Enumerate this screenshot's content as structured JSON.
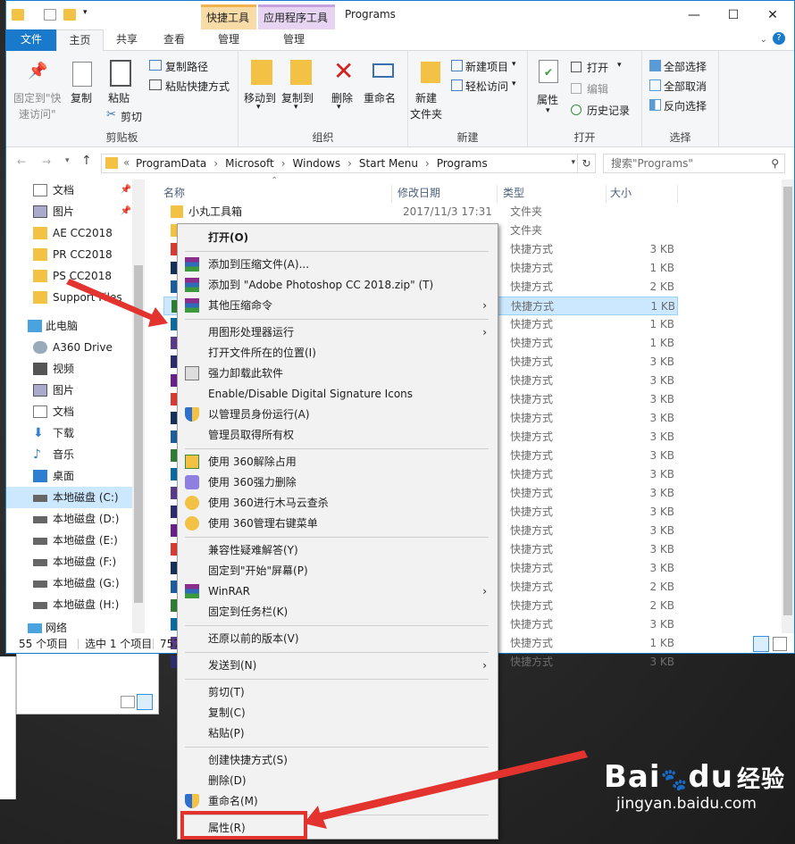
{
  "window": {
    "title": "Programs",
    "context_tab_1": "快捷工具",
    "context_tab_2": "应用程序工具",
    "minimize": "—",
    "maximize": "☐",
    "close": "✕"
  },
  "tabs": [
    "文件",
    "主页",
    "共享",
    "查看",
    "管理",
    "管理"
  ],
  "ribbon": {
    "pin_quick": [
      "固定到\"快",
      "速访问\""
    ],
    "copy": "复制",
    "paste": "粘贴",
    "copy_path": "复制路径",
    "paste_shortcut": "粘贴快捷方式",
    "cut": "剪切",
    "clipboard_group": "剪贴板",
    "move_to": "移动到",
    "copy_to": "复制到",
    "delete": "删除",
    "rename": "重命名",
    "organize_group": "组织",
    "new_item": "新建项目",
    "easy_access": "轻松访问",
    "new_folder": [
      "新建",
      "文件夹"
    ],
    "new_group": "新建",
    "properties": "属性",
    "open": "打开",
    "edit": "编辑",
    "history": "历史记录",
    "open_group": "打开",
    "select_all": "全部选择",
    "select_none": "全部取消",
    "invert_select": "反向选择",
    "select_group": "选择"
  },
  "address": {
    "path": [
      "ProgramData",
      "Microsoft",
      "Windows",
      "Start Menu",
      "Programs"
    ],
    "search_placeholder": "搜索\"Programs\""
  },
  "nav_items": [
    "文档",
    "图片",
    "AE CC2018",
    "PR CC2018",
    "PS CC2018",
    "Support Files",
    "此电脑",
    "A360 Drive",
    "视频",
    "图片",
    "文档",
    "下载",
    "音乐",
    "桌面",
    "本地磁盘 (C:)",
    "本地磁盘 (D:)",
    "本地磁盘 (E:)",
    "本地磁盘 (F:)",
    "本地磁盘 (G:)",
    "本地磁盘 (H:)",
    "网络"
  ],
  "columns": {
    "name": "名称",
    "date": "修改日期",
    "type": "类型",
    "size": "大小"
  },
  "rows": [
    {
      "name": "小丸工具箱",
      "date": "2017/11/3 17:31",
      "type": "文件夹",
      "size": ""
    },
    {
      "name": "",
      "date": "",
      "type": "文件夹",
      "size": ""
    },
    {
      "name": "",
      "date": "",
      "type": "快捷方式",
      "size": "3 KB"
    },
    {
      "name": "",
      "date": "",
      "type": "快捷方式",
      "size": "1 KB"
    },
    {
      "name": "",
      "date": "",
      "type": "快捷方式",
      "size": "2 KB"
    },
    {
      "name": "",
      "date": "",
      "type": "快捷方式",
      "size": "1 KB"
    },
    {
      "name": "",
      "date": "",
      "type": "快捷方式",
      "size": "1 KB"
    },
    {
      "name": "",
      "date": "",
      "type": "快捷方式",
      "size": "1 KB"
    },
    {
      "name": "",
      "date": "",
      "type": "快捷方式",
      "size": "3 KB"
    },
    {
      "name": "",
      "date": "",
      "type": "快捷方式",
      "size": "3 KB"
    },
    {
      "name": "",
      "date": "",
      "type": "快捷方式",
      "size": "3 KB"
    },
    {
      "name": "",
      "date": "",
      "type": "快捷方式",
      "size": "3 KB"
    },
    {
      "name": "",
      "date": "",
      "type": "快捷方式",
      "size": "3 KB"
    },
    {
      "name": "",
      "date": "",
      "type": "快捷方式",
      "size": "3 KB"
    },
    {
      "name": "",
      "date": "",
      "type": "快捷方式",
      "size": "3 KB"
    },
    {
      "name": "",
      "date": "",
      "type": "快捷方式",
      "size": "3 KB"
    },
    {
      "name": "",
      "date": "",
      "type": "快捷方式",
      "size": "3 KB"
    },
    {
      "name": "",
      "date": "",
      "type": "快捷方式",
      "size": "3 KB"
    },
    {
      "name": "",
      "date": "",
      "type": "快捷方式",
      "size": "3 KB"
    },
    {
      "name": "",
      "date": "",
      "type": "快捷方式",
      "size": "3 KB"
    },
    {
      "name": "",
      "date": "",
      "type": "快捷方式",
      "size": "2 KB"
    },
    {
      "name": "",
      "date": "",
      "type": "快捷方式",
      "size": "2 KB"
    },
    {
      "name": "",
      "date": "",
      "type": "快捷方式",
      "size": "3 KB"
    },
    {
      "name": "",
      "date": "",
      "type": "快捷方式",
      "size": "1 KB"
    },
    {
      "name": "",
      "date": "",
      "type": "快捷方式",
      "size": "3 KB"
    }
  ],
  "status": {
    "count": "55 个项目",
    "selected": "选中 1 个项目",
    "size": "757"
  },
  "menu": [
    {
      "label": "打开(O)",
      "bold": true
    },
    {
      "sep": true
    },
    {
      "label": "添加到压缩文件(A)...",
      "icon": "winrar"
    },
    {
      "label": "添加到 \"Adobe Photoshop CC 2018.zip\" (T)",
      "icon": "winrar"
    },
    {
      "label": "其他压缩命令",
      "icon": "winrar",
      "arrow": true
    },
    {
      "sep": true
    },
    {
      "label": "用图形处理器运行",
      "arrow": true
    },
    {
      "label": "打开文件所在的位置(I)"
    },
    {
      "label": "强力卸载此软件",
      "icon": "trash"
    },
    {
      "label": "Enable/Disable Digital Signature Icons"
    },
    {
      "label": "以管理员身份运行(A)",
      "icon": "shield"
    },
    {
      "label": "管理员取得所有权"
    },
    {
      "sep": true
    },
    {
      "label": "使用 360解除占用",
      "icon": "360a"
    },
    {
      "label": "使用 360强力删除",
      "icon": "360b"
    },
    {
      "label": "使用 360进行木马云查杀",
      "icon": "360c"
    },
    {
      "label": "使用 360管理右键菜单",
      "icon": "360c"
    },
    {
      "sep": true
    },
    {
      "label": "兼容性疑难解答(Y)"
    },
    {
      "label": "固定到\"开始\"屏幕(P)"
    },
    {
      "label": "WinRAR",
      "icon": "winrar",
      "arrow": true
    },
    {
      "label": "固定到任务栏(K)"
    },
    {
      "sep": true
    },
    {
      "label": "还原以前的版本(V)"
    },
    {
      "sep": true
    },
    {
      "label": "发送到(N)",
      "arrow": true
    },
    {
      "sep": true
    },
    {
      "label": "剪切(T)"
    },
    {
      "label": "复制(C)"
    },
    {
      "label": "粘贴(P)"
    },
    {
      "sep": true
    },
    {
      "label": "创建快捷方式(S)"
    },
    {
      "label": "删除(D)"
    },
    {
      "label": "重命名(M)",
      "icon": "shield"
    },
    {
      "sep": true
    },
    {
      "label": "属性(R)"
    }
  ],
  "watermark": {
    "brand": "Bai",
    "brand2": "du",
    "brand_cn": "经验",
    "url": "jingyan.baidu.com"
  },
  "colors": {
    "accent": "#1979ca",
    "selected": "#cce8ff",
    "highlight_red": "#e2332f"
  }
}
